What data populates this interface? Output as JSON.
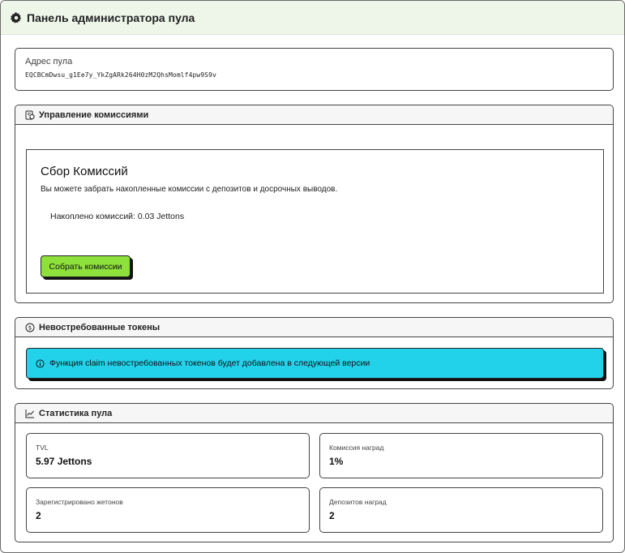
{
  "header": {
    "title": "Панель администратора пула",
    "icon": "gear-icon"
  },
  "pool_address": {
    "label": "Адрес пула",
    "value": "EQCBCmDwsu_g1Ee7y_YkZgARk264H0zM2QhsMomlf4pw9S9v"
  },
  "fees": {
    "section_title": "Управление комиссиями",
    "section_icon": "receipt-icon",
    "box_title": "Сбор Комиссий",
    "description": "Вы можете забрать накопленные комиссии с депозитов и досрочных выводов.",
    "accumulated": "Накоплено комиссий: 0.03 Jettons",
    "collect_button": "Собрать комиссии"
  },
  "unclaimed": {
    "section_title": "Невостребованные токены",
    "section_icon": "coin-icon",
    "info_icon": "info-icon",
    "info_text": "Функция claim невостребованных токенов будет добавлена в следующей версии"
  },
  "stats": {
    "section_title": "Статистика пула",
    "section_icon": "chart-line-icon",
    "items": [
      {
        "label": "TVL",
        "value": "5.97 Jettons"
      },
      {
        "label": "Комиссия наград",
        "value": "1%"
      },
      {
        "label": "Зарегистрировано жетонов",
        "value": "2"
      },
      {
        "label": "Депозитов наград",
        "value": "2"
      }
    ]
  },
  "colors": {
    "accent_green": "#8ee13a",
    "info_cyan": "#22d2ea",
    "header_bg": "#eef6ea"
  }
}
